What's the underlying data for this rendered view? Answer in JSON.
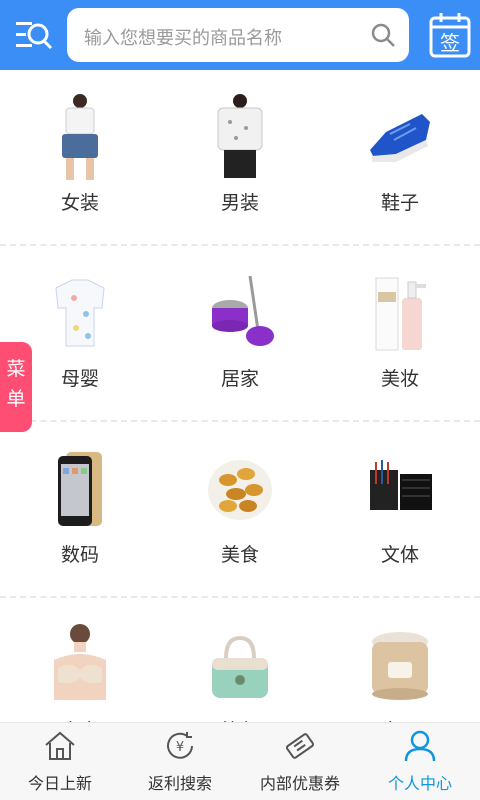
{
  "colors": {
    "primary": "#3a8ef6",
    "active_tab": "#1296db",
    "side_tab": "#ff4e73"
  },
  "header": {
    "menu_icon": "search-menu-icon",
    "search_placeholder": "输入您想要买的商品名称",
    "search_icon": "search-icon",
    "sign_label": "签"
  },
  "side_tab": {
    "label_1": "菜",
    "label_2": "单"
  },
  "categories": [
    {
      "label": "女装",
      "icon": "womens-clothing-image"
    },
    {
      "label": "男装",
      "icon": "mens-clothing-image"
    },
    {
      "label": "鞋子",
      "icon": "shoes-image"
    },
    {
      "label": "母婴",
      "icon": "baby-image"
    },
    {
      "label": "居家",
      "icon": "home-image"
    },
    {
      "label": "美妆",
      "icon": "cosmetics-image"
    },
    {
      "label": "数码",
      "icon": "phone-image"
    },
    {
      "label": "美食",
      "icon": "food-image"
    },
    {
      "label": "文体",
      "icon": "stationery-image"
    },
    {
      "label": "内衣",
      "icon": "underwear-image"
    },
    {
      "label": "箱包",
      "icon": "bag-image"
    },
    {
      "label": "电器",
      "icon": "appliance-image"
    }
  ],
  "tabs": [
    {
      "label": "今日上新",
      "icon": "home-icon"
    },
    {
      "label": "返利搜索",
      "icon": "rebate-icon"
    },
    {
      "label": "内部优惠券",
      "icon": "coupon-icon"
    },
    {
      "label": "个人中心",
      "icon": "user-icon",
      "active": true
    }
  ]
}
